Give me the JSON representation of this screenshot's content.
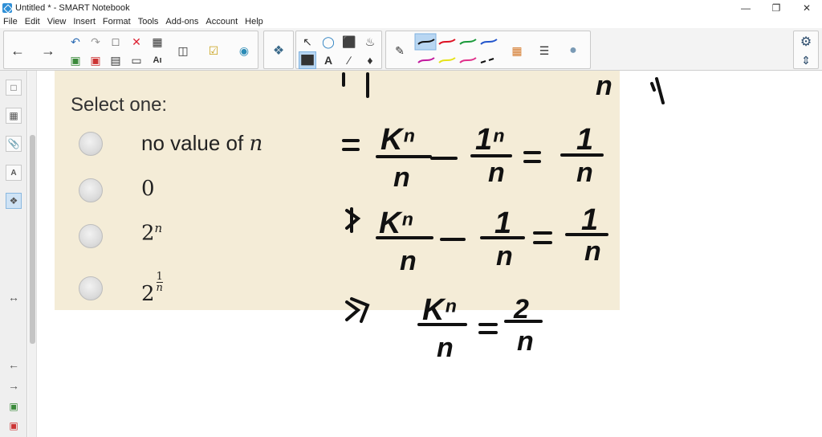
{
  "window": {
    "title": "Untitled * - SMART Notebook",
    "minimize": "—",
    "restore": "❐",
    "close": "✕"
  },
  "menu": [
    "File",
    "Edit",
    "View",
    "Insert",
    "Format",
    "Tools",
    "Add-ons",
    "Account",
    "Help"
  ],
  "question": {
    "prompt": "Select one:",
    "options": [
      {
        "text": "no value of ",
        "var": "n"
      },
      {
        "text": "0"
      },
      {
        "text": "2",
        "sup": "n"
      },
      {
        "text": "2",
        "frac_num": "1",
        "frac_den": "n"
      }
    ]
  },
  "handwriting": {
    "line1": {
      "k": "Kⁿ",
      "d1": "n",
      "o": "1ⁿ",
      "d2": "n",
      "r": "1",
      "d3": "n"
    },
    "line2": {
      "k": "Kⁿ",
      "d1": "n",
      "o": "1",
      "d2": "n",
      "r": "1",
      "d3": "n"
    },
    "line3": {
      "k": "Kⁿ",
      "d1": "n",
      "r": "2",
      "d3": "n"
    }
  },
  "colors": {
    "panel": "#f4ecd7",
    "ink": "#111111",
    "select": "#b8d6f2"
  }
}
